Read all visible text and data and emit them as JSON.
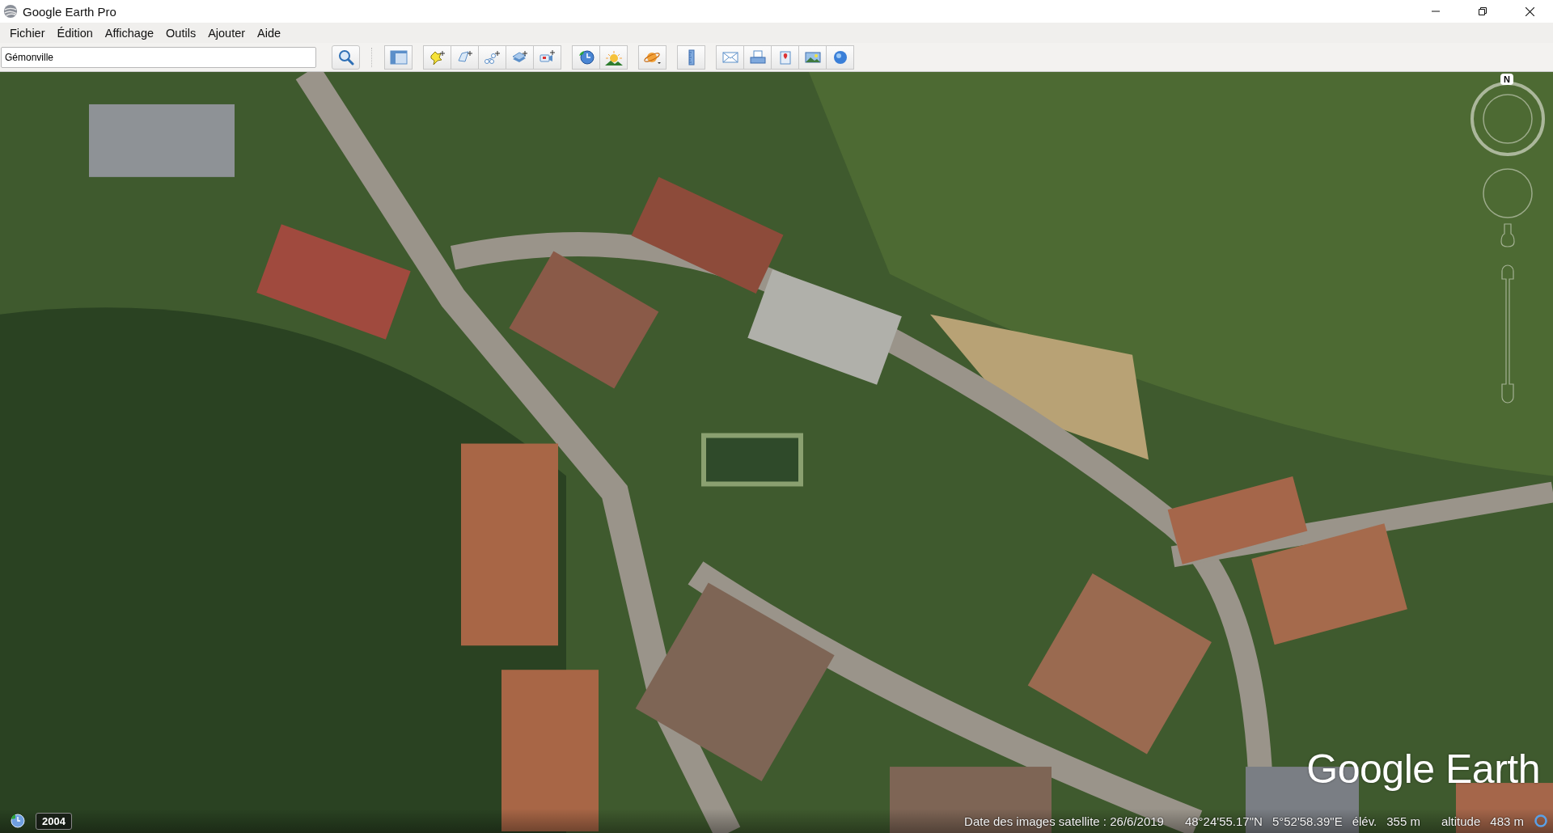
{
  "window": {
    "title": "Google Earth Pro"
  },
  "menu": [
    "Fichier",
    "Édition",
    "Affichage",
    "Outils",
    "Ajouter",
    "Aide"
  ],
  "search": {
    "value": "Gémonville"
  },
  "map": {
    "compass_label": "N",
    "logo": "Google Earth",
    "historical_year": "2004"
  },
  "status_bar": {
    "imagery_date": "Date des images satellite : 26/6/2019",
    "latitude": "48°24'55.17\"N",
    "longitude": "5°52'58.39\"E",
    "elevation_label": "élév.",
    "elevation": "355 m",
    "altitude_label": "altitude",
    "altitude": "483 m"
  }
}
